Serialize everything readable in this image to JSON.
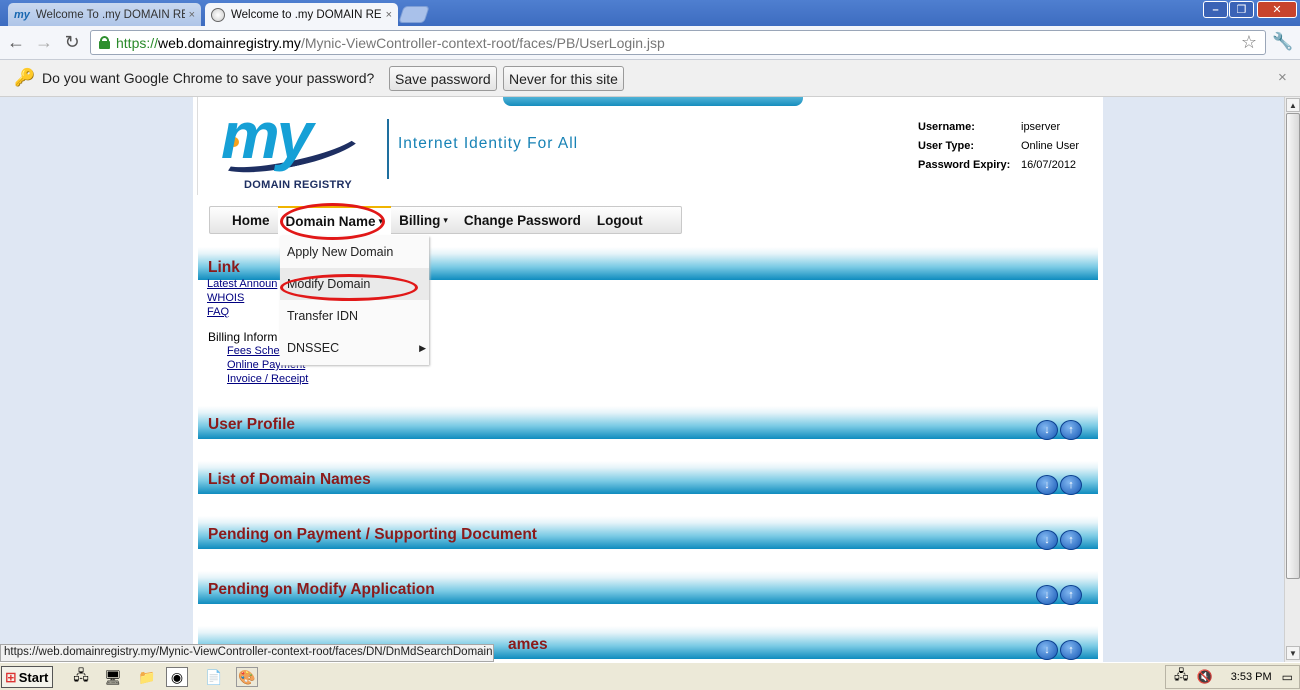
{
  "browser": {
    "tabs": [
      {
        "label": "Welcome To .my DOMAIN REG",
        "icon": "my-favicon"
      },
      {
        "label": "Welcome to .my DOMAIN REG",
        "icon": "globe-icon"
      }
    ],
    "close_glyph": "×",
    "window_buttons": [
      "–",
      "❐",
      "✕"
    ],
    "url": {
      "scheme": "https://",
      "host": "web.domainregistry.my",
      "path": "/Mynic-ViewController-context-root/faces/PB/UserLogin.jsp"
    },
    "password_prompt": {
      "text": "Do you want Google Chrome to save your password?",
      "save_label": "Save password",
      "never_label": "Never for this site"
    },
    "status_url": "https://web.domainregistry.my/Mynic-ViewController-context-root/faces/DN/DnMdSearchDomain.jspx"
  },
  "site": {
    "logo_text": "my",
    "logo_sub": "DOMAIN REGISTRY",
    "tagline": "Internet Identity For All",
    "user_info": [
      {
        "label": "Username:",
        "value": "ipserver"
      },
      {
        "label": "User Type:",
        "value": "Online User"
      },
      {
        "label": "Password Expiry:",
        "value": "16/07/2012"
      }
    ],
    "menu": [
      {
        "label": "Home",
        "has_arrow": false
      },
      {
        "label": "Domain Name",
        "has_arrow": true
      },
      {
        "label": "Billing",
        "has_arrow": true
      },
      {
        "label": "Change Password",
        "has_arrow": false
      },
      {
        "label": "Logout",
        "has_arrow": false
      }
    ],
    "dropdown": [
      "Apply New Domain",
      "Modify Domain",
      "Transfer IDN",
      "DNSSEC"
    ],
    "link_section": {
      "title": "Link",
      "links": [
        "Latest Announ",
        "WHOIS",
        "FAQ"
      ],
      "billing_label": "Billing Inform",
      "billing_links": [
        "Fees Sche",
        "Online Payment",
        "Invoice / Receipt"
      ]
    },
    "sections": [
      "User Profile",
      "List of Domain Names",
      "Pending on Payment / Supporting Document",
      "Pending on Modify Application",
      "ames"
    ]
  },
  "taskbar": {
    "start_label": "Start",
    "clock": "3:53 PM"
  },
  "colors": {
    "section_title": "#8b1a1a",
    "highlight_oval": "#e11818",
    "link": "#000080"
  }
}
